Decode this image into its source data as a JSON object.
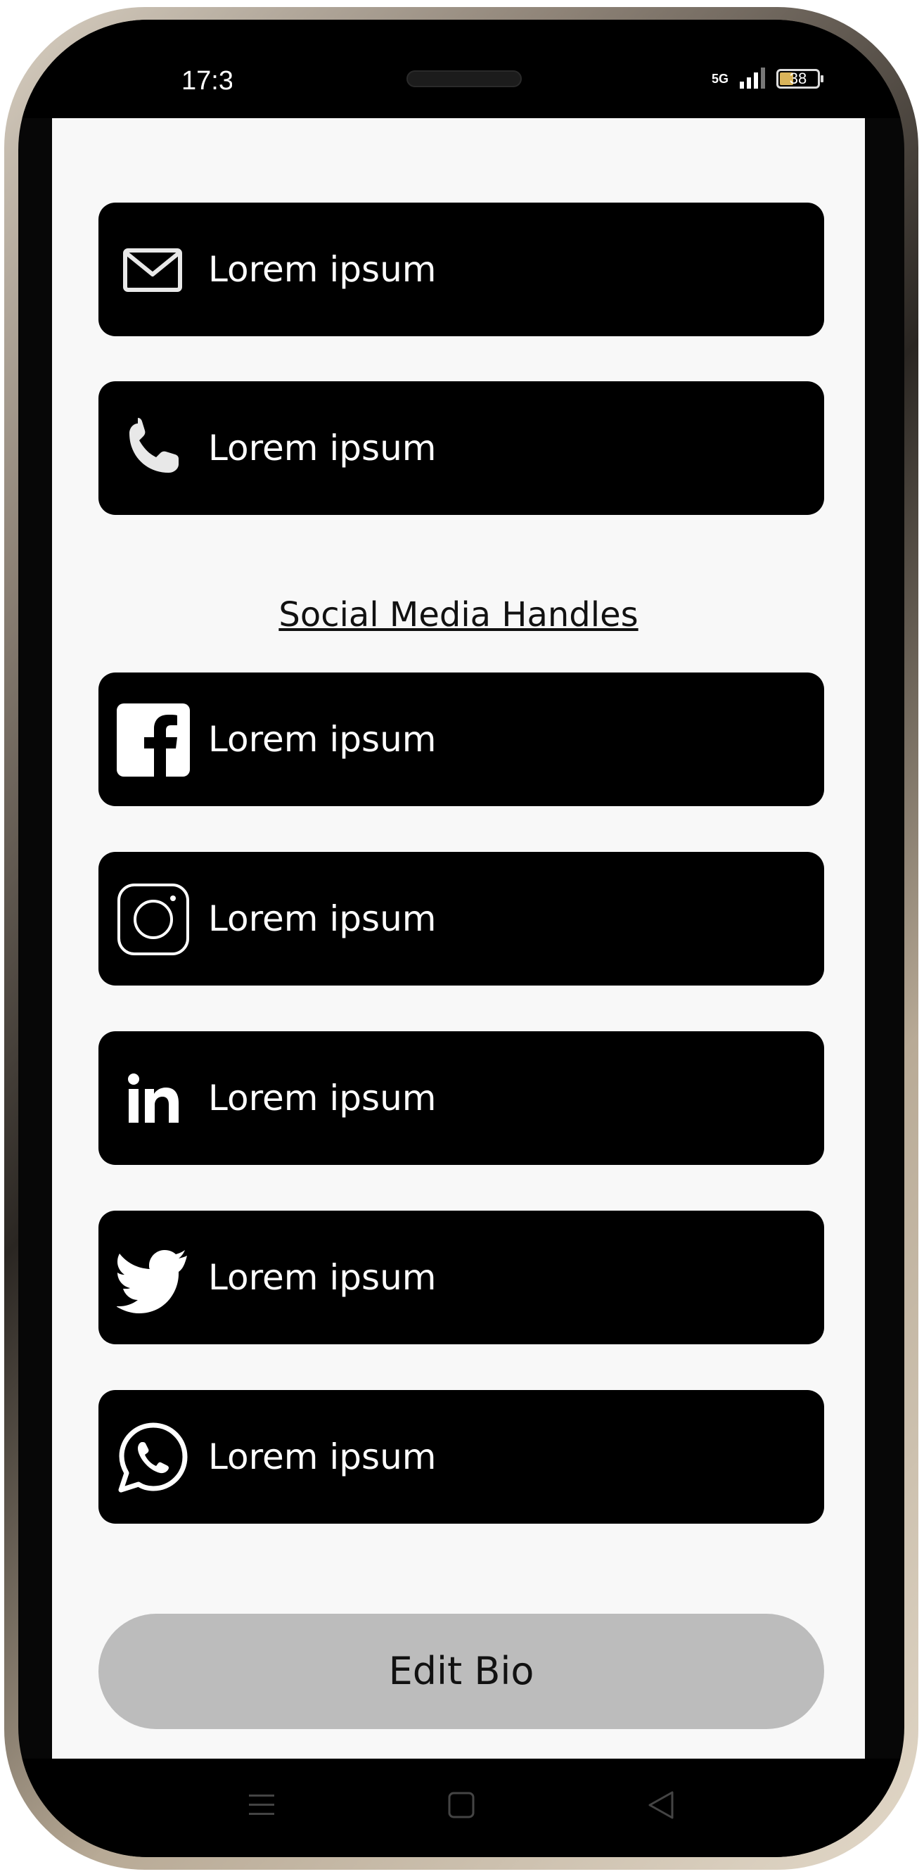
{
  "status_bar": {
    "time": "17:3",
    "network": "5G",
    "battery_level": "38",
    "battery_fraction": 0.38
  },
  "contact_items": [
    {
      "icon": "mail-icon",
      "label": "Lorem ipsum"
    },
    {
      "icon": "phone-icon",
      "label": "Lorem ipsum"
    }
  ],
  "social_section": {
    "title": "Social Media Handles",
    "items": [
      {
        "icon": "facebook-icon",
        "label": "Lorem ipsum"
      },
      {
        "icon": "instagram-icon",
        "label": "Lorem ipsum"
      },
      {
        "icon": "linkedin-icon",
        "label": "Lorem ipsum"
      },
      {
        "icon": "twitter-icon",
        "label": "Lorem ipsum"
      },
      {
        "icon": "whatsapp-icon",
        "label": "Lorem ipsum"
      }
    ]
  },
  "edit_button": {
    "label": "Edit Bio"
  },
  "nav_bar": {
    "items": [
      "menu-icon",
      "home-square-icon",
      "back-triangle-icon"
    ]
  },
  "colors": {
    "card_bg": "#000000",
    "card_text": "#ffffff",
    "screen_bg": "#f8f8f8",
    "button_bg": "#bcbcbc"
  }
}
